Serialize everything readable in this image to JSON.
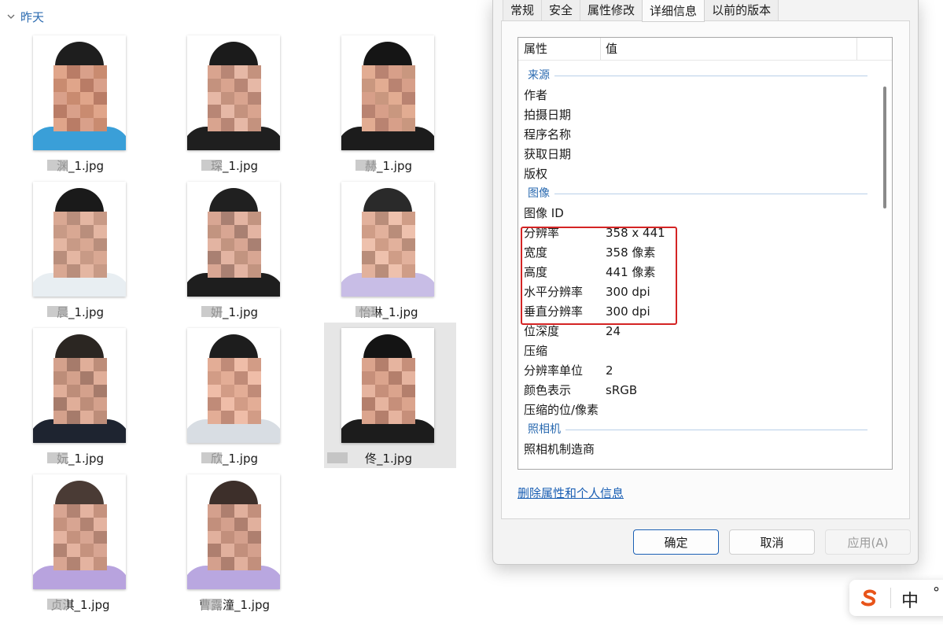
{
  "explorer": {
    "group_label": "昨天",
    "items": [
      {
        "filename": "渊_1.jpg",
        "shirt": "#3a9fd8",
        "hair": "#1e1e1e",
        "skin": [
          "#e0a58a",
          "#c98b70",
          "#d9a08a",
          "#b97c66"
        ]
      },
      {
        "filename": "琛_1.jpg",
        "shirt": "#1f1f1f",
        "hair": "#1b1b1b",
        "skin": [
          "#d9a48f",
          "#c4927e",
          "#e6b8a6",
          "#b88675"
        ]
      },
      {
        "filename": "赫_1.jpg",
        "shirt": "#1c1c1c",
        "hair": "#151515",
        "skin": [
          "#e2ac92",
          "#c9977f",
          "#d79f89",
          "#b98371"
        ]
      },
      {
        "filename": "晨_1.jpg",
        "shirt": "#e8eef2",
        "hair": "#1a1a1a",
        "skin": [
          "#d9a893",
          "#c89a86",
          "#e4b6a2",
          "#b98e7c"
        ]
      },
      {
        "filename": "妍_1.jpg",
        "shirt": "#1e1e1e",
        "hair": "#202020",
        "skin": [
          "#d8a693",
          "#c29480",
          "#e3b4a2",
          "#a98072"
        ]
      },
      {
        "filename": "怡琳_1.jpg",
        "shirt": "#c8bde6",
        "hair": "#2a2a2a",
        "skin": [
          "#e2b19c",
          "#cf9d87",
          "#eec1ad",
          "#b98d7a"
        ]
      },
      {
        "filename": "妧_1.jpg",
        "shirt": "#1e2430",
        "hair": "#2b2622",
        "skin": [
          "#d4a18c",
          "#bd8d79",
          "#e0ae99",
          "#a67b6b"
        ]
      },
      {
        "filename": "欣_1.jpg",
        "shirt": "#d8dde3",
        "hair": "#1d1d1d",
        "skin": [
          "#e3ad96",
          "#d29c86",
          "#efbda8",
          "#c08b78"
        ]
      },
      {
        "filename": "佟_1.jpg",
        "shirt": "#1c1c1c",
        "hair": "#141414",
        "skin": [
          "#dba48d",
          "#c68f7a",
          "#e6b49f",
          "#b47f6c"
        ]
      },
      {
        "filename": "贞淇_1.jpg",
        "shirt": "#b8a3de",
        "hair": "#4a3b35",
        "skin": [
          "#d8a592",
          "#c5927e",
          "#e4b3a0",
          "#b28372"
        ]
      },
      {
        "filename": "曹露潼_1.jpg",
        "shirt": "#b9a7e0",
        "hair": "#3d2f2a",
        "skin": [
          "#d4a08d",
          "#c28f7c",
          "#e1b09d",
          "#ae7f6f"
        ]
      }
    ]
  },
  "dialog": {
    "tabs": [
      "常规",
      "安全",
      "属性修改",
      "详细信息",
      "以前的版本"
    ],
    "active_tab": 3,
    "columns": {
      "property": "属性",
      "value": "值"
    },
    "rows": [
      {
        "kind": "section",
        "label": "来源"
      },
      {
        "kind": "item",
        "key": "作者",
        "value": ""
      },
      {
        "kind": "item",
        "key": "拍摄日期",
        "value": ""
      },
      {
        "kind": "item",
        "key": "程序名称",
        "value": ""
      },
      {
        "kind": "item",
        "key": "获取日期",
        "value": ""
      },
      {
        "kind": "item",
        "key": "版权",
        "value": ""
      },
      {
        "kind": "section",
        "label": "图像"
      },
      {
        "kind": "item",
        "key": "图像 ID",
        "value": ""
      },
      {
        "kind": "item",
        "key": "分辨率",
        "value": "358 x 441"
      },
      {
        "kind": "item",
        "key": "宽度",
        "value": "358 像素"
      },
      {
        "kind": "item",
        "key": "高度",
        "value": "441 像素"
      },
      {
        "kind": "item",
        "key": "水平分辨率",
        "value": "300 dpi"
      },
      {
        "kind": "item",
        "key": "垂直分辨率",
        "value": "300 dpi"
      },
      {
        "kind": "item",
        "key": "位深度",
        "value": "24"
      },
      {
        "kind": "item",
        "key": "压缩",
        "value": ""
      },
      {
        "kind": "item",
        "key": "分辨率单位",
        "value": "2"
      },
      {
        "kind": "item",
        "key": "颜色表示",
        "value": "sRGB"
      },
      {
        "kind": "item",
        "key": "压缩的位/像素",
        "value": ""
      },
      {
        "kind": "section",
        "label": "照相机"
      },
      {
        "kind": "item",
        "key": "照相机制造商",
        "value": ""
      }
    ],
    "remove_link": "删除属性和个人信息",
    "buttons": {
      "ok": "确定",
      "cancel": "取消",
      "apply": "应用(A)"
    },
    "highlight_color": "#d42424"
  },
  "ime": {
    "logo": "S",
    "mode": "中",
    "punct": "°"
  }
}
